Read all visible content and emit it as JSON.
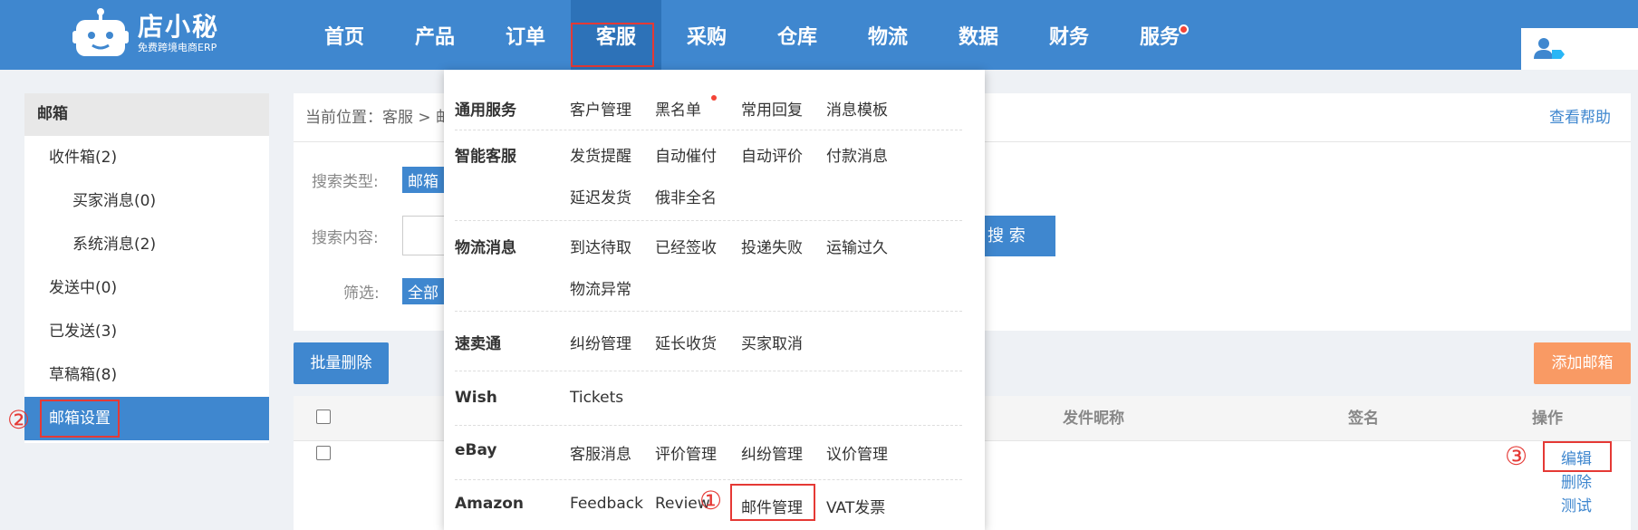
{
  "header": {
    "logo_name": "店小秘",
    "logo_sub": "免费跨境电商ERP",
    "nav": [
      "首页",
      "产品",
      "订单",
      "客服",
      "采购",
      "仓库",
      "物流",
      "数据",
      "财务",
      "服务"
    ],
    "active_nav": "客服",
    "badge_color": "#f44336"
  },
  "sidebar": {
    "heading": "邮箱",
    "items": [
      "收件箱(2)",
      "买家消息(0)",
      "系统消息(2)",
      "发送中(0)",
      "已发送(3)",
      "草稿箱(8)",
      "邮箱设置"
    ],
    "active": "邮箱设置",
    "step": "②"
  },
  "main": {
    "crumb": "当前位置：客服 > 邮",
    "help": "查看帮助",
    "search_type_label": "搜索类型:",
    "search_type_value": "邮箱",
    "search_content_label": "搜索内容:",
    "search_button": "搜 索",
    "filter_label": "筛选:",
    "filter_value": "全部",
    "batch_delete": "批量删除",
    "add_mailbox": "添加邮箱",
    "columns": {
      "nickname": "发件昵称",
      "signature": "签名",
      "actions": "操作"
    },
    "row_actions": [
      "编辑",
      "删除",
      "测试"
    ],
    "step": "③"
  },
  "dropdown": {
    "sections": [
      {
        "category": "通用服务",
        "links": [
          "客户管理",
          "黑名单",
          "常用回复",
          "消息模板"
        ]
      },
      {
        "category": "智能客服",
        "links": [
          "发货提醒",
          "自动催付",
          "自动评价",
          "付款消息",
          "延迟发货",
          "俄非全名"
        ]
      },
      {
        "category": "物流消息",
        "links": [
          "到达待取",
          "已经签收",
          "投递失败",
          "运输过久",
          "物流异常"
        ]
      },
      {
        "category": "速卖通",
        "links": [
          "纠纷管理",
          "延长收货",
          "买家取消"
        ]
      },
      {
        "category": "Wish",
        "links": [
          "Tickets"
        ]
      },
      {
        "category": "eBay",
        "links": [
          "客服消息",
          "评价管理",
          "纠纷管理",
          "议价管理"
        ]
      },
      {
        "category": "Amazon",
        "links": [
          "Feedback",
          "Review",
          "邮件管理",
          "VAT发票"
        ]
      }
    ],
    "step": "①"
  },
  "colors": {
    "primary": "#3f87cf",
    "highlight": "#e53935",
    "orange": "#f99a64"
  }
}
